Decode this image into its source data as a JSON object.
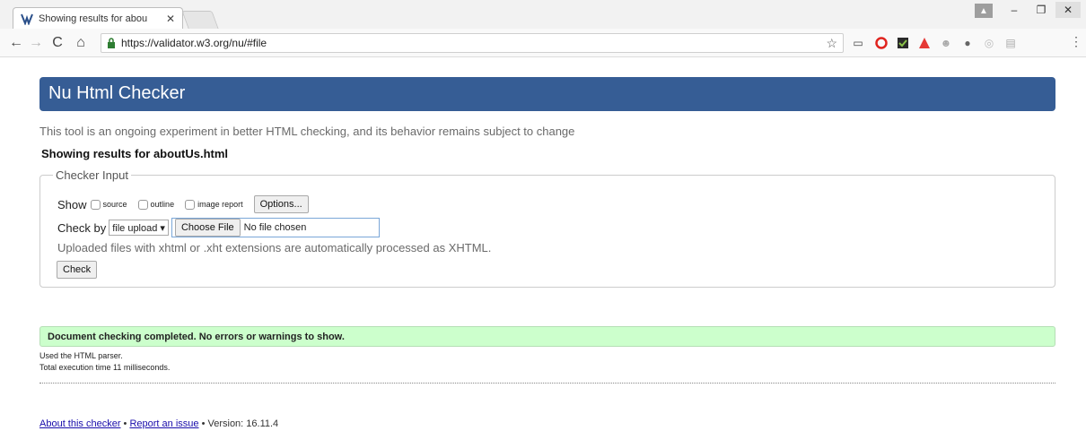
{
  "browser": {
    "tab_title": "Showing results for abou",
    "tab_close": "✕",
    "url": "https://validator.w3.org/nu/#file",
    "window_controls": {
      "minimize": "–",
      "restore": "❐",
      "close": "✕"
    }
  },
  "page": {
    "heading": "Nu Html Checker",
    "intro": "This tool is an ongoing experiment in better HTML checking, and its behavior remains subject to change",
    "results_for": "Showing results for aboutUs.html"
  },
  "checker": {
    "legend": "Checker Input",
    "show_label": "Show",
    "options": [
      {
        "label": "source"
      },
      {
        "label": "outline"
      },
      {
        "label": "image report"
      }
    ],
    "options_button": "Options...",
    "check_by_label": "Check by",
    "check_by_value": "file upload ▾",
    "choose_file_button": "Choose File",
    "no_file_text": "No file chosen",
    "hint": "Uploaded files with xhtml or .xht extensions are automatically processed as XHTML.",
    "check_button": "Check"
  },
  "results": {
    "success": "Document checking completed. No errors or warnings to show.",
    "parser": "Used the HTML parser.",
    "time": "Total execution time 11 milliseconds."
  },
  "footer": {
    "about_link": "About this checker",
    "dot1": " • ",
    "report_link": "Report an issue",
    "dot2": " • ",
    "version": "Version: 16.11.4"
  },
  "colors": {
    "header_bg": "#365d95",
    "success_bg": "#ccffcc",
    "link": "#1a0dab"
  }
}
